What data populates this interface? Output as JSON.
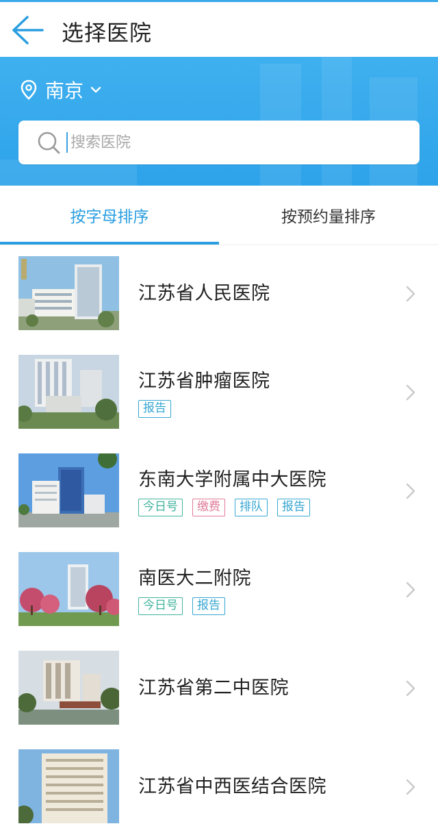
{
  "header": {
    "title": "选择医院",
    "back_icon": "arrow-left-icon"
  },
  "location": {
    "city": "南京",
    "icon": "map-pin-icon",
    "dropdown_icon": "chevron-down-icon"
  },
  "search": {
    "placeholder": "搜索医院",
    "icon": "search-icon"
  },
  "tabs": [
    {
      "label": "按字母排序",
      "active": true
    },
    {
      "label": "按预约量排序",
      "active": false
    }
  ],
  "colors": {
    "accent": "#2a9ee0",
    "band": "#3fb0ef",
    "tag_blue": "#36a6d2",
    "tag_green": "#3fb39b",
    "tag_red": "#e07a98"
  },
  "hospitals": [
    {
      "name": "江苏省人民医院",
      "tags": []
    },
    {
      "name": "江苏省肿瘤医院",
      "tags": [
        {
          "label": "报告",
          "style": "blue"
        }
      ]
    },
    {
      "name": "东南大学附属中大医院",
      "tags": [
        {
          "label": "今日号",
          "style": "green"
        },
        {
          "label": "缴费",
          "style": "red"
        },
        {
          "label": "排队",
          "style": "blue"
        },
        {
          "label": "报告",
          "style": "blue"
        }
      ]
    },
    {
      "name": "南医大二附院",
      "tags": [
        {
          "label": "今日号",
          "style": "green"
        },
        {
          "label": "报告",
          "style": "blue"
        }
      ]
    },
    {
      "name": "江苏省第二中医院",
      "tags": []
    },
    {
      "name": "江苏省中西医结合医院",
      "tags": []
    }
  ]
}
